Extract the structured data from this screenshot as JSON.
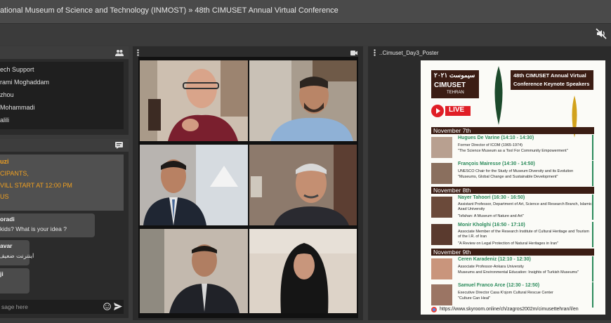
{
  "header": {
    "title": "ational Museum of Science and Technology (INMOST)  »  48th CIMUSET Annual Virtual Conference"
  },
  "users": {
    "items": [
      "ech Support",
      "rami Moghaddam",
      "zhou",
      "Mohammadi",
      "alili"
    ]
  },
  "chat": {
    "notice_lines": [
      "uzi",
      "CIPANTS,",
      "VILL START AT 12:00 PM",
      "US"
    ],
    "messages": [
      {
        "who": "oradi",
        "text": "kids? What is your idea ?"
      },
      {
        "who": "avar",
        "text": "اینترنت ضعیف"
      },
      {
        "who": "ji",
        "text": ""
      }
    ],
    "input_placeholder": "sage here"
  },
  "poster": {
    "panel_title": "..Cimuset_Day3_Poster",
    "logo_top": "۲۰۲۱ سیموست",
    "logo_main": "CIMUSET",
    "logo_city": "TEHRAN",
    "header_line1": "48th CIMUSET Annual Virtual",
    "header_line2": "Conference Keynote Speakers",
    "live": "LIVE",
    "days": [
      {
        "label": "November 7th",
        "speakers": [
          {
            "name": "Hugues De Varine (14:10 - 14:30)",
            "role": "Former Director of ICOM (1965-1974)",
            "topic": "\"The Science Museum as a Tool For Community Empowerment\""
          },
          {
            "name": "François Mairesse (14:30 - 14:50)",
            "role": "UNESCO Chair for the Study of Museum Diversity and its Evolution",
            "topic": "\"Museums, Global Change and Sustainable Development\""
          }
        ]
      },
      {
        "label": "November 8th",
        "speakers": [
          {
            "name": "Nayer Tahoori (16:30 - 16:50)",
            "role": "Assistant Professor, Department of Art, Science and Research Branch, Islamic Azad University",
            "topic": "\"Isfahan: A Museum of Nature and Art\""
          },
          {
            "name": "Monir Kholghi (16:50 - 17:10)",
            "role": "Associate Member of the Research Institute of Cultural Heritage and Tourism of the I.R. of Iran",
            "topic": "\"A Review on Legal Protection of Natural Heritages in Iran\""
          }
        ]
      },
      {
        "label": "November 9th",
        "speakers": [
          {
            "name": "Ceren Karadeniz (12:10 - 12:30)",
            "role": "Associate Professor-Ankara University",
            "topic": "Museums and Environmental Education: Insights of Turkish Museums\""
          },
          {
            "name": "Samuel Franco Arce (12:30 - 12:50)",
            "role": "Executive Director Casa K'ojom Cultural Rescue Center",
            "topic": "\"Culture Can Heal\""
          }
        ]
      }
    ],
    "url": "https://www.skyroom.online/ch/zagros2002m/cimusettehran/l/en"
  },
  "colors": {
    "accent_orange": "#f0a020",
    "poster_green": "#2a8a5a",
    "live_red": "#e01e26"
  }
}
